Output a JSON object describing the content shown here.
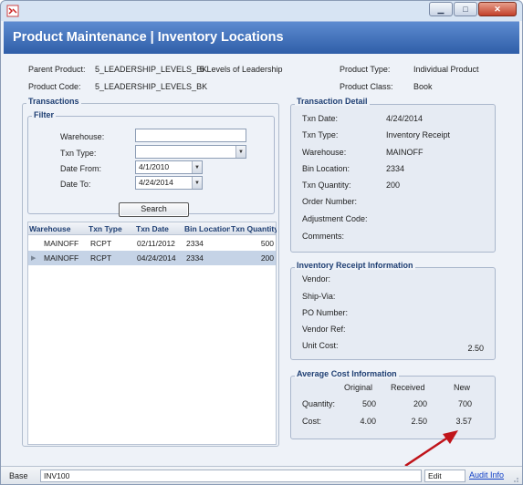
{
  "header": {
    "title": "Product Maintenance  |  Inventory Locations"
  },
  "product": {
    "parent_label": "Parent Product:",
    "parent_value": "5_LEADERSHIP_LEVELS_BK",
    "parent_desc": "5 Levels of Leadership",
    "code_label": "Product Code:",
    "code_value": "5_LEADERSHIP_LEVELS_BK",
    "type_label": "Product Type:",
    "type_value": "Individual Product",
    "class_label": "Product Class:",
    "class_value": "Book"
  },
  "transactions": {
    "section_title": "Transactions",
    "filter_title": "Filter",
    "warehouse_label": "Warehouse:",
    "warehouse_value": "",
    "txn_type_label": "Txn Type:",
    "txn_type_value": "",
    "date_from_label": "Date From:",
    "date_from_value": "4/1/2010",
    "date_to_label": "Date To:",
    "date_to_value": "4/24/2014",
    "search_label": "Search",
    "columns": [
      "Warehouse",
      "Txn Type",
      "Txn Date",
      "Bin Location",
      "Txn Quantity"
    ],
    "rows": [
      {
        "warehouse": "MAINOFF",
        "type": "RCPT",
        "date": "02/11/2012",
        "bin": "2334",
        "qty": "500"
      },
      {
        "warehouse": "MAINOFF",
        "type": "RCPT",
        "date": "04/24/2014",
        "bin": "2334",
        "qty": "200"
      }
    ]
  },
  "detail": {
    "title": "Transaction Detail",
    "txn_date_label": "Txn Date:",
    "txn_date_value": "4/24/2014",
    "txn_type_label": "Txn Type:",
    "txn_type_value": "Inventory Receipt",
    "warehouse_label": "Warehouse:",
    "warehouse_value": "MAINOFF",
    "bin_label": "Bin Location:",
    "bin_value": "2334",
    "qty_label": "Txn Quantity:",
    "qty_value": "200",
    "order_label": "Order Number:",
    "adjustment_label": "Adjustment Code:",
    "comments_label": "Comments:"
  },
  "receipt": {
    "title": "Inventory Receipt Information",
    "vendor_label": "Vendor:",
    "shipvia_label": "Ship-Via:",
    "po_label": "PO Number:",
    "vendorref_label": "Vendor Ref:",
    "unitcost_label": "Unit Cost:",
    "unitcost_value": "2.50"
  },
  "avgcost": {
    "title": "Average Cost Information",
    "col_original": "Original",
    "col_received": "Received",
    "col_new": "New",
    "quantity_label": "Quantity:",
    "quantity_original": "500",
    "quantity_received": "200",
    "quantity_new": "700",
    "cost_label": "Cost:",
    "cost_original": "4.00",
    "cost_received": "2.50",
    "cost_new": "3.57"
  },
  "status": {
    "base_label": "Base",
    "form_code": "INV100",
    "mode": "Edit",
    "audit_label": "Audit Info"
  },
  "colors": {
    "header": "#2f5ea8",
    "section": "#1f3f73",
    "arrow": "#c0141a",
    "link": "#1140c8"
  },
  "icons": [
    "app-icon",
    "minimize-icon",
    "maximize-icon",
    "close-icon",
    "dropdown-arrow-icon",
    "row-indicator-icon",
    "resize-grip-icon",
    "annotation-arrow"
  ]
}
